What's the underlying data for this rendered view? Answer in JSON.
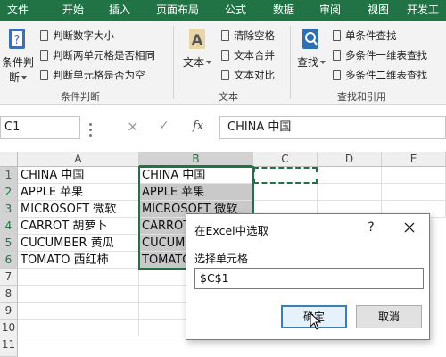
{
  "ribbon": {
    "tabs": [
      "文件",
      "开始",
      "插入",
      "页面布局",
      "公式",
      "数据",
      "审阅",
      "视图",
      "开发工"
    ],
    "groups": {
      "condition": {
        "big_label_1": "条件判",
        "big_label_2": "断",
        "items": [
          "判断数字大小",
          "判断两单元格是否相同",
          "判断单元格是否为空"
        ],
        "group_label": "条件判断"
      },
      "text": {
        "big_label": "文本",
        "items": [
          "清除空格",
          "文本合并",
          "文本对比"
        ],
        "group_label": "文本"
      },
      "lookup": {
        "big_label": "查找",
        "items": [
          "单条件查找",
          "多条件一维表查找",
          "多条件二维表查找"
        ],
        "group_label": "查找和引用"
      }
    }
  },
  "formula_bar": {
    "name_box": "C1",
    "cancel_icon": "×",
    "enter_icon": "✓",
    "fx_icon": "fx",
    "content": "CHINA 中国"
  },
  "sheet": {
    "columns": [
      "A",
      "B",
      "C",
      "D",
      "E"
    ],
    "rows": [
      "1",
      "2",
      "3",
      "4",
      "5",
      "6",
      "7",
      "8",
      "9",
      "10",
      "11"
    ],
    "colA": [
      "CHINA 中国",
      "APPLE 苹果",
      "MICROSOFT 微软",
      "CARROT 胡萝卜",
      "CUCUMBER 黄瓜",
      "TOMATO 西红柿"
    ],
    "colB": [
      "CHINA 中国",
      "APPLE 苹果",
      "MICROSOFT 微软",
      "CARROT 胡萝卜",
      "CUCUMBER 黄瓜",
      "TOMATO 西红柿"
    ]
  },
  "dialog": {
    "title": "在Excel中选取",
    "help": "?",
    "label": "选择单元格",
    "value": "$C$1",
    "ok": "确定",
    "cancel": "取消"
  },
  "colors": {
    "accent": "#217346",
    "selection_shade": "#c9c9c9"
  }
}
